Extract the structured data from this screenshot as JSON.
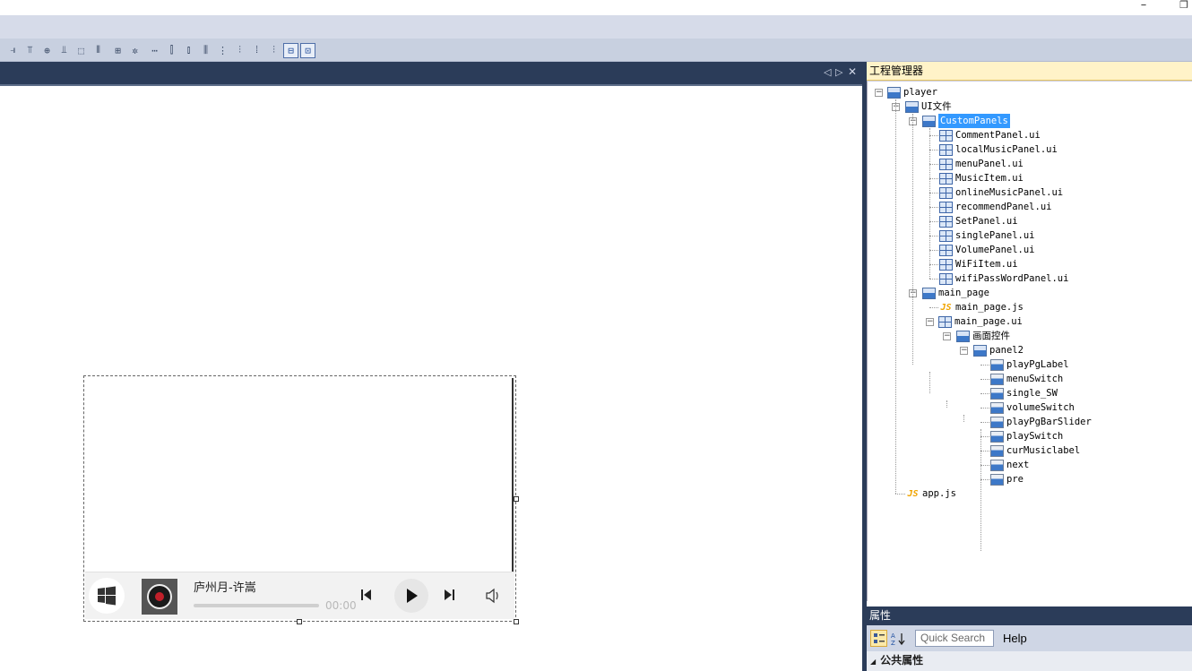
{
  "window": {
    "minimize_glyph": "–",
    "restore_glyph": "❐"
  },
  "toolbar": {
    "buttons": [
      {
        "icon": "align-right-icon",
        "glyph": "⫣"
      },
      {
        "icon": "align-top-icon",
        "glyph": "⫪"
      },
      {
        "icon": "align-middle-icon",
        "glyph": "⊕"
      },
      {
        "icon": "align-bottom-icon",
        "glyph": "⫫"
      },
      {
        "icon": "same-width-icon",
        "glyph": "⬚"
      },
      {
        "icon": "same-height-icon",
        "glyph": "⫴"
      },
      {
        "icon": "same-size-icon",
        "glyph": "⊞"
      },
      {
        "icon": "center-gear-icon",
        "glyph": "✲"
      },
      {
        "icon": "h-spacing-equal-icon",
        "glyph": "⋯"
      },
      {
        "icon": "h-spacing-increase-icon",
        "glyph": "⫿"
      },
      {
        "icon": "h-spacing-decrease-icon",
        "glyph": "⫾"
      },
      {
        "icon": "h-spacing-remove-icon",
        "glyph": "⫼"
      },
      {
        "icon": "v-spacing-equal-icon",
        "glyph": "⋮"
      },
      {
        "icon": "v-spacing-increase-icon",
        "glyph": "⫶"
      },
      {
        "icon": "v-spacing-decrease-icon",
        "glyph": "⁞"
      },
      {
        "icon": "v-spacing-remove-icon",
        "glyph": "⫶"
      },
      {
        "icon": "center-horizontal-icon",
        "glyph": "⊟"
      },
      {
        "icon": "center-vertical-icon",
        "glyph": "⊡"
      }
    ]
  },
  "doc_tabs": {
    "scroll_left": "◁",
    "scroll_right": "▷",
    "close": "✕"
  },
  "player": {
    "song_title": "庐州月-许嵩",
    "time": "00:00"
  },
  "project_explorer": {
    "title": "工程管理器",
    "tree": {
      "root": "player",
      "ui_folder": "UI文件",
      "custom_panels": "CustomPanels",
      "panel_files": [
        "CommentPanel.ui",
        "localMusicPanel.ui",
        "menuPanel.ui",
        "MusicItem.ui",
        "onlineMusicPanel.ui",
        "recommendPanel.ui",
        "SetPanel.ui",
        "singlePanel.ui",
        "VolumePanel.ui",
        "WiFiItem.ui",
        "wifiPassWordPanel.ui"
      ],
      "main_page": "main_page",
      "main_page_js": "main_page.js",
      "main_page_ui": "main_page.ui",
      "screen_controls": "画面控件",
      "panel2": "panel2",
      "controls": [
        "playPgLabel",
        "menuSwitch",
        "single_SW",
        "volumeSwitch",
        "playPgBarSlider",
        "playSwitch",
        "curMusiclabel",
        "next",
        "pre"
      ],
      "app_js": "app.js"
    }
  },
  "properties": {
    "title": "属性",
    "search_placeholder": "Quick Search",
    "help": "Help",
    "category": "公共属性",
    "category_arrow": "◢"
  }
}
